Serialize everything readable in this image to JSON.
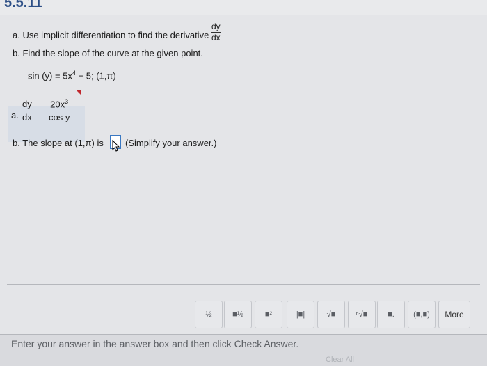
{
  "header": {
    "title": "5.5.11"
  },
  "problem": {
    "part_a": "a. Use implicit differentiation to find the derivative",
    "deriv_num": "dy",
    "deriv_den": "dx",
    "part_b": "b. Find the slope of the curve at the given point.",
    "equation": "sin (y) = 5x",
    "equation_exp": "4",
    "equation_tail": " − 5; (1,π)"
  },
  "answer_a": {
    "label": "a.",
    "lhs_num": "dy",
    "lhs_den": "dx",
    "equals": "=",
    "rhs_num": "20x",
    "rhs_exp": "3",
    "rhs_den": "cos y"
  },
  "answer_b": {
    "prefix": "b. The slope at (1,π) is",
    "hint": "(Simplify your answer.)"
  },
  "toolbar": {
    "buttons": [
      {
        "icon": "fraction-icon",
        "glyph": "½"
      },
      {
        "icon": "mixed-number-icon",
        "glyph": "■½"
      },
      {
        "icon": "exponent-icon",
        "glyph": "■²"
      },
      {
        "icon": "absolute-value-icon",
        "glyph": "|■|"
      },
      {
        "icon": "sqrt-icon",
        "glyph": "√■"
      },
      {
        "icon": "nth-root-icon",
        "glyph": "ⁿ√■"
      },
      {
        "icon": "decimal-icon",
        "glyph": "■."
      },
      {
        "icon": "interval-icon",
        "glyph": "(■,■)"
      }
    ],
    "more": "More"
  },
  "footer": {
    "instruction": "Enter your answer in the answer box and then click Check Answer.",
    "clear_all": "Clear All"
  }
}
